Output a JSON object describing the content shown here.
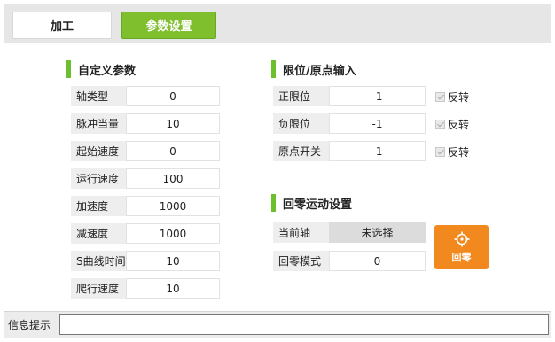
{
  "tabs": {
    "process": "加工",
    "params": "参数设置"
  },
  "custom_params": {
    "title": "自定义参数",
    "rows": [
      {
        "label": "轴类型",
        "value": "0"
      },
      {
        "label": "脉冲当量",
        "value": "10"
      },
      {
        "label": "起始速度",
        "value": "0"
      },
      {
        "label": "运行速度",
        "value": "100"
      },
      {
        "label": "加速度",
        "value": "1000"
      },
      {
        "label": "减速度",
        "value": "1000"
      },
      {
        "label": "S曲线时间",
        "value": "10"
      },
      {
        "label": "爬行速度",
        "value": "10"
      }
    ]
  },
  "limit_input": {
    "title": "限位/原点输入",
    "rows": [
      {
        "label": "正限位",
        "value": "-1",
        "invert_label": "反转"
      },
      {
        "label": "负限位",
        "value": "-1",
        "invert_label": "反转"
      },
      {
        "label": "原点开关",
        "value": "-1",
        "invert_label": "反转"
      }
    ]
  },
  "homing": {
    "title": "回零运动设置",
    "current_axis_label": "当前轴",
    "current_axis_value": "未选择",
    "mode_label": "回零模式",
    "mode_value": "0",
    "button_label": "回零",
    "button_icon": "crosshair-icon"
  },
  "message": {
    "label": "信息提示",
    "value": ""
  },
  "colors": {
    "accent_green": "#7fbf2e",
    "home_orange": "#f2891f"
  }
}
